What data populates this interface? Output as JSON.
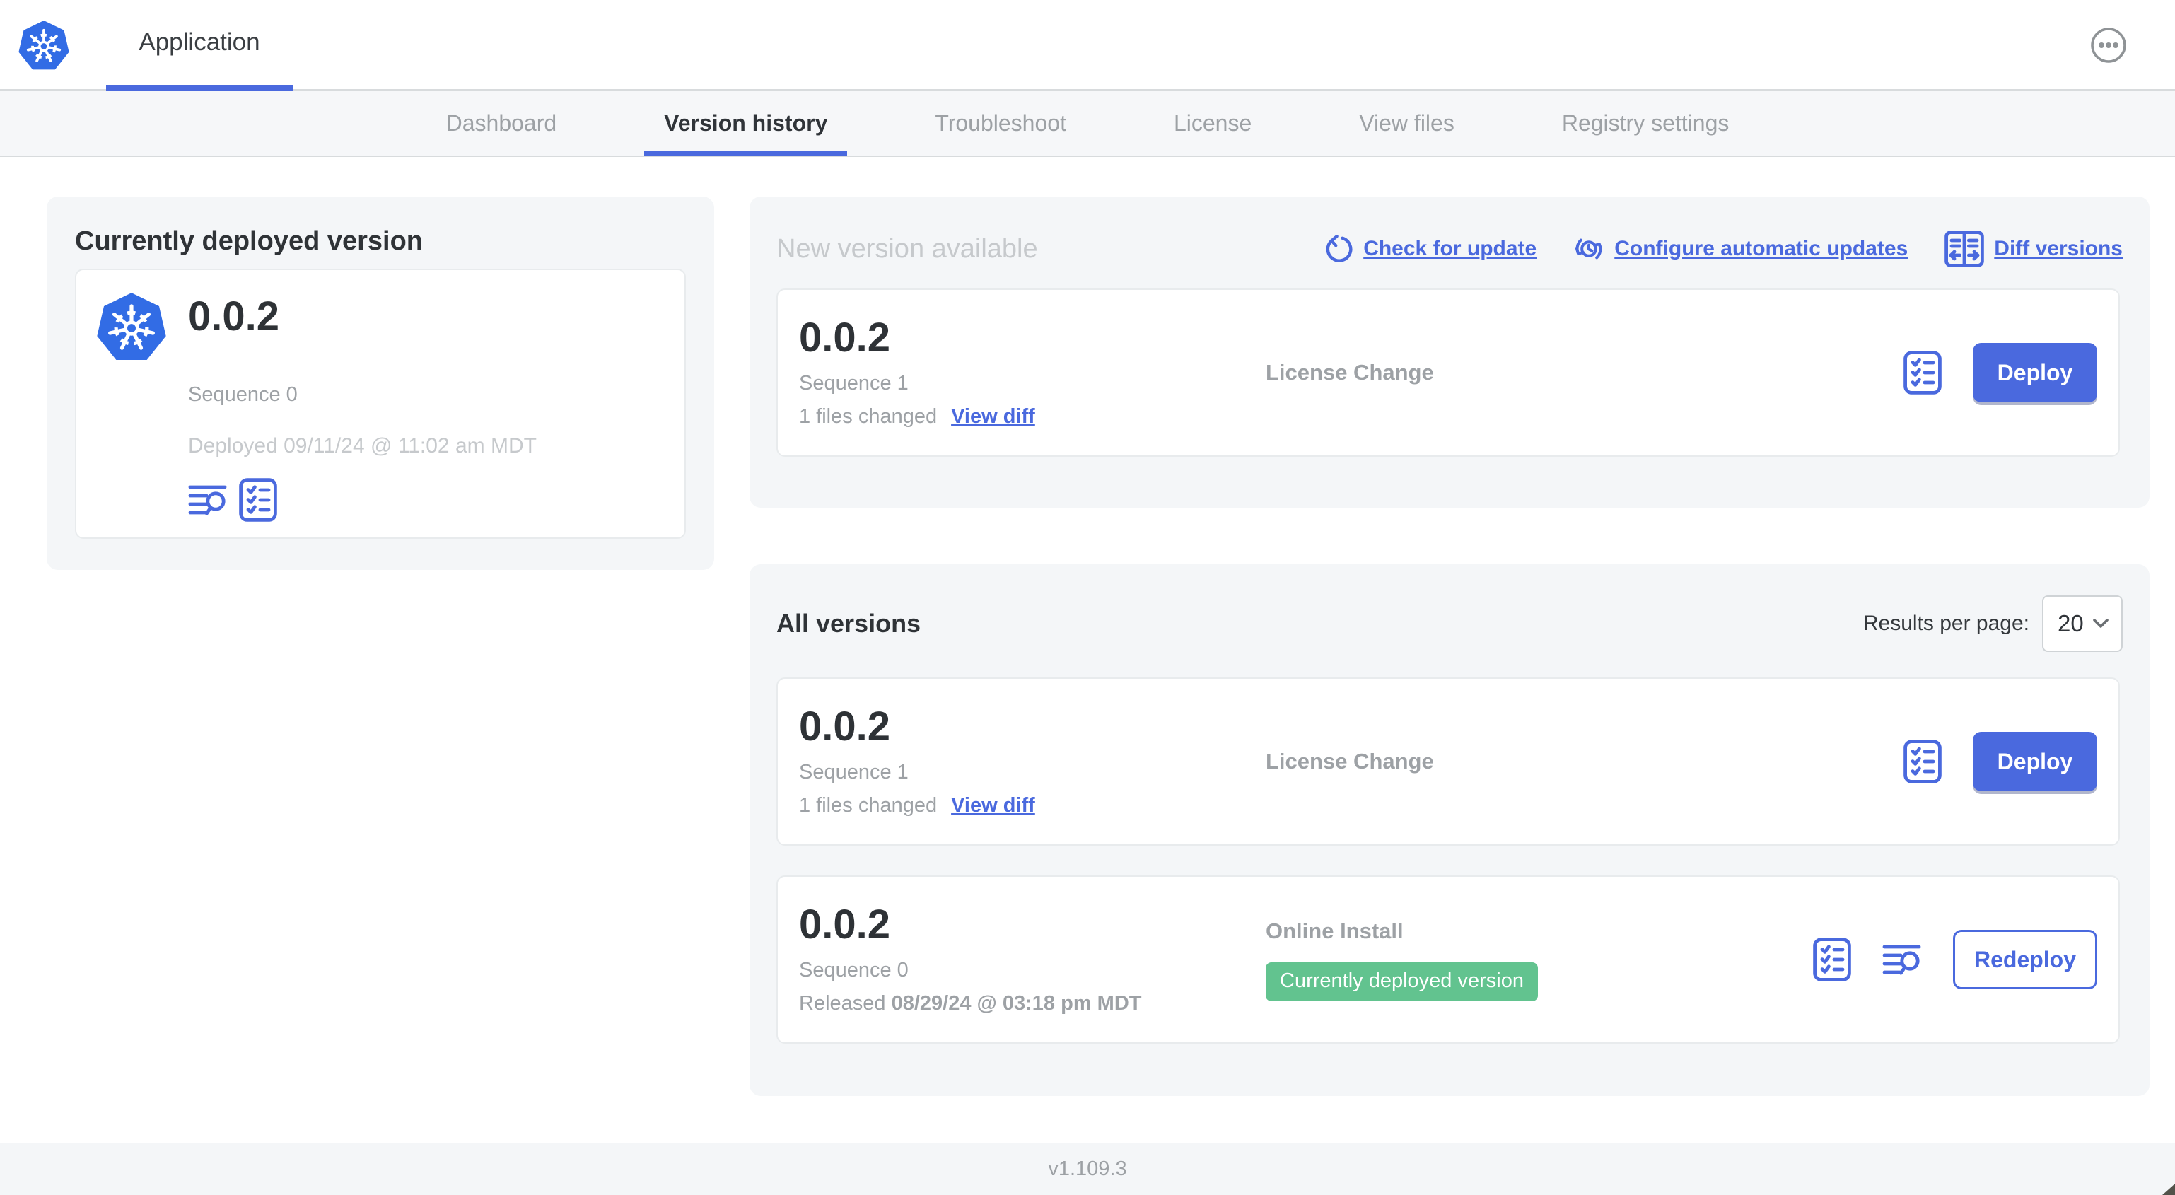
{
  "colors": {
    "accent": "#4a69de",
    "k8s_blue": "#326ce5",
    "badge_green": "#62c38f"
  },
  "header": {
    "app_title": "Application"
  },
  "nav": {
    "tabs": [
      {
        "label": "Dashboard",
        "active": false
      },
      {
        "label": "Version history",
        "active": true
      },
      {
        "label": "Troubleshoot",
        "active": false
      },
      {
        "label": "License",
        "active": false
      },
      {
        "label": "View files",
        "active": false
      },
      {
        "label": "Registry settings",
        "active": false
      }
    ]
  },
  "current_panel": {
    "title": "Currently deployed version",
    "version": "0.0.2",
    "sequence": "Sequence 0",
    "deployed": "Deployed 09/11/24 @ 11:02 am MDT",
    "icons": [
      "logs-icon",
      "config-checklist-icon"
    ]
  },
  "new_version_panel": {
    "title": "New version available",
    "actions": [
      {
        "label": "Check for update",
        "icon": "refresh-icon"
      },
      {
        "label": "Configure automatic updates",
        "icon": "auto-update-clock-icon"
      },
      {
        "label": "Diff versions",
        "icon": "diff-icon"
      }
    ],
    "row": {
      "version": "0.0.2",
      "sequence": "Sequence 1",
      "files_changed": "1 files changed",
      "view_diff_label": "View diff",
      "source": "License Change",
      "deploy_label": "Deploy"
    }
  },
  "all_versions_panel": {
    "title": "All versions",
    "results_per_page_label": "Results per page:",
    "results_per_page_value": "20",
    "rows": [
      {
        "version": "0.0.2",
        "sequence": "Sequence 1",
        "files_changed": "1 files changed",
        "view_diff_label": "View diff",
        "source": "License Change",
        "action_label": "Deploy"
      },
      {
        "version": "0.0.2",
        "sequence": "Sequence 0",
        "released_prefix": "Released",
        "released_date": "08/29/24 @ 03:18 pm MDT",
        "source": "Online Install",
        "badge": "Currently deployed version",
        "action_label": "Redeploy"
      }
    ]
  },
  "footer": {
    "app_version": "v1.109.3"
  }
}
